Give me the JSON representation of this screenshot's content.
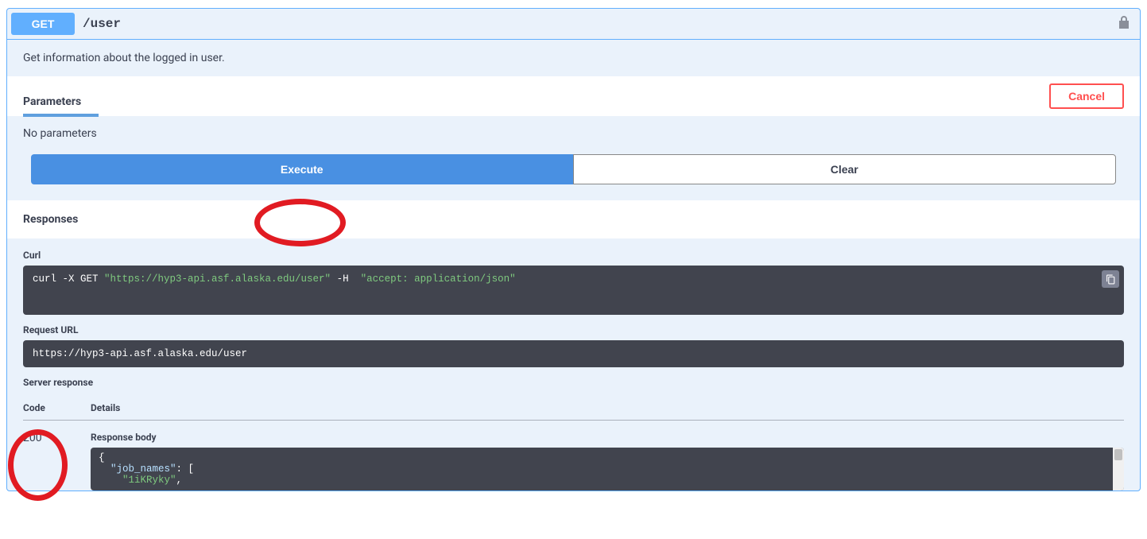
{
  "op": {
    "method": "GET",
    "path": "/user",
    "summary": "Get information about the logged in user."
  },
  "tabs": {
    "parameters": "Parameters",
    "cancel": "Cancel"
  },
  "params": {
    "empty_text": "No parameters"
  },
  "buttons": {
    "execute": "Execute",
    "clear": "Clear"
  },
  "responses": {
    "header": "Responses",
    "curl_label": "Curl",
    "curl_prefix": "curl -X GET ",
    "curl_url": "\"https://hyp3-api.asf.alaska.edu/user\"",
    "curl_mid": " -H  ",
    "curl_header": "\"accept: application/json\"",
    "request_url_label": "Request URL",
    "request_url": "https://hyp3-api.asf.alaska.edu/user",
    "server_response_label": "Server response",
    "col_code": "Code",
    "col_details": "Details",
    "status_code": "200",
    "response_body_label": "Response body",
    "body_line1": "{",
    "body_key1": "  \"job_names\"",
    "body_after_key1": ": [",
    "body_str1": "    \"1iKRyky\"",
    "body_after_str1": ","
  }
}
